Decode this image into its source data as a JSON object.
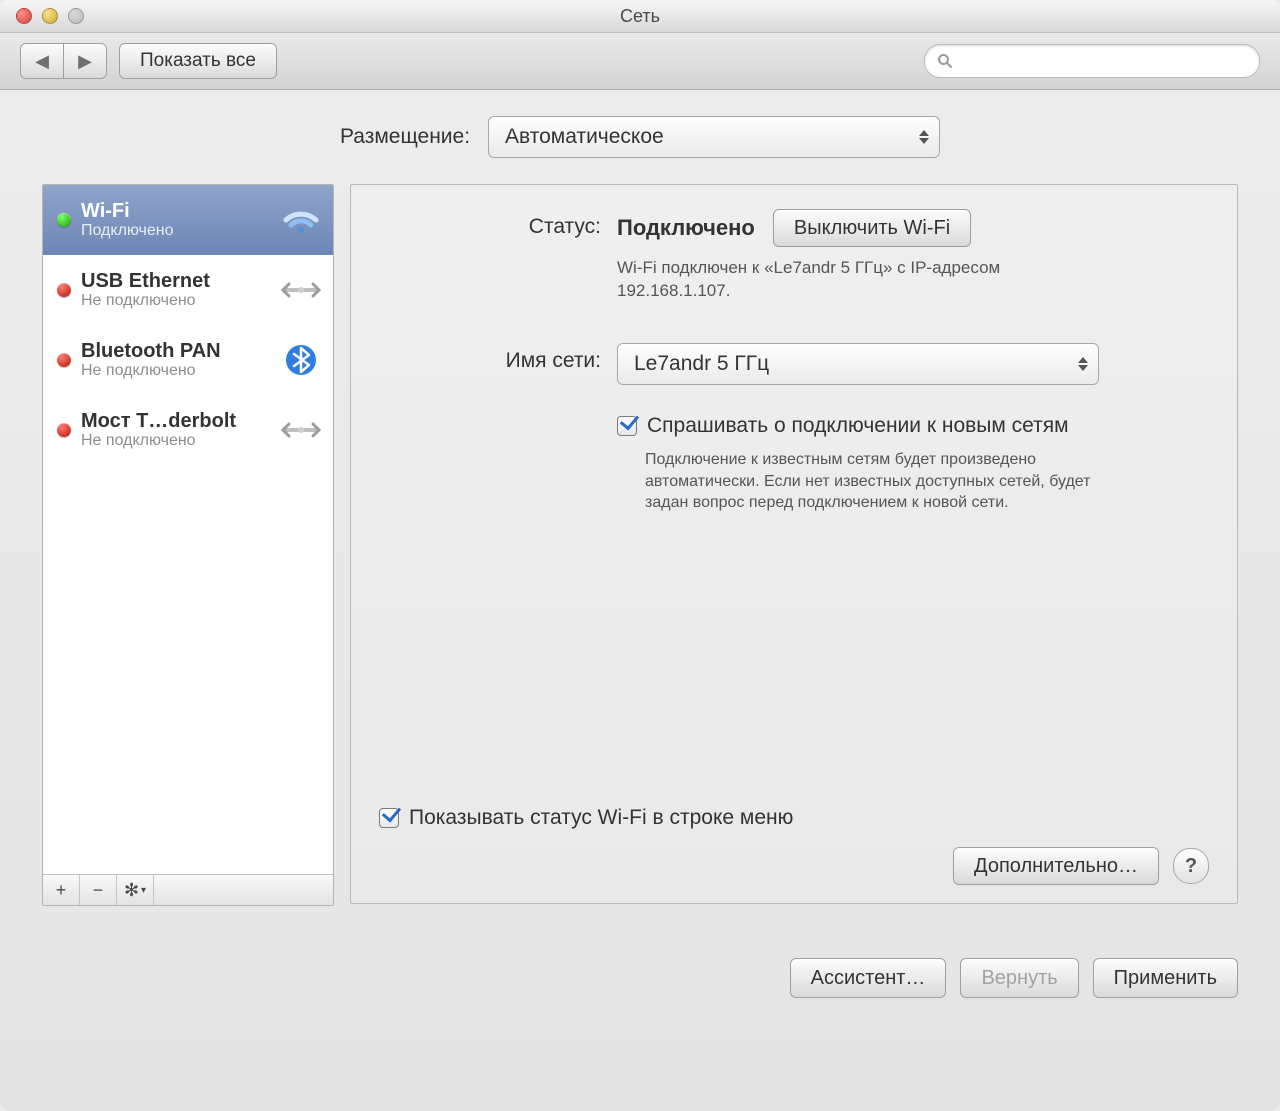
{
  "window": {
    "title": "Сеть"
  },
  "toolbar": {
    "show_all": "Показать все",
    "search_placeholder": " "
  },
  "location": {
    "label": "Размещение:",
    "popup_value": "Автоматическое"
  },
  "sidebar": {
    "items": [
      {
        "name": "Wi-Fi",
        "status": "Подключено",
        "dot": "g",
        "icon": "wifi",
        "selected": true
      },
      {
        "name": "USB Ethernet",
        "status": "Не подключено",
        "dot": "r",
        "icon": "ethernet",
        "selected": false
      },
      {
        "name": "Bluetooth PAN",
        "status": "Не подключено",
        "dot": "r",
        "icon": "bluetooth",
        "selected": false
      },
      {
        "name": "Мост T…derbolt",
        "status": "Не подключено",
        "dot": "r",
        "icon": "ethernet",
        "selected": false
      }
    ]
  },
  "detail": {
    "status_label": "Статус:",
    "status_value": "Подключено",
    "wifi_off_btn": "Выключить Wi-Fi",
    "status_desc": "Wi-Fi подключен к «Le7andr 5 ГГц» с IP-адресом 192.168.1.107.",
    "network_label": "Имя сети:",
    "network_value": "Le7andr 5 ГГц",
    "ask_join_label": "Спрашивать о подключении к новым сетям",
    "ask_join_hint": "Подключение к известным сетям будет произведено автоматически. Если нет известных доступных сетей, будет задан вопрос перед подключением к новой сети.",
    "show_menubar_label": "Показывать статус Wi-Fi в строке меню",
    "advanced_btn": "Дополнительно…"
  },
  "footer": {
    "assist": "Ассистент…",
    "revert": "Вернуть",
    "apply": "Применить"
  }
}
